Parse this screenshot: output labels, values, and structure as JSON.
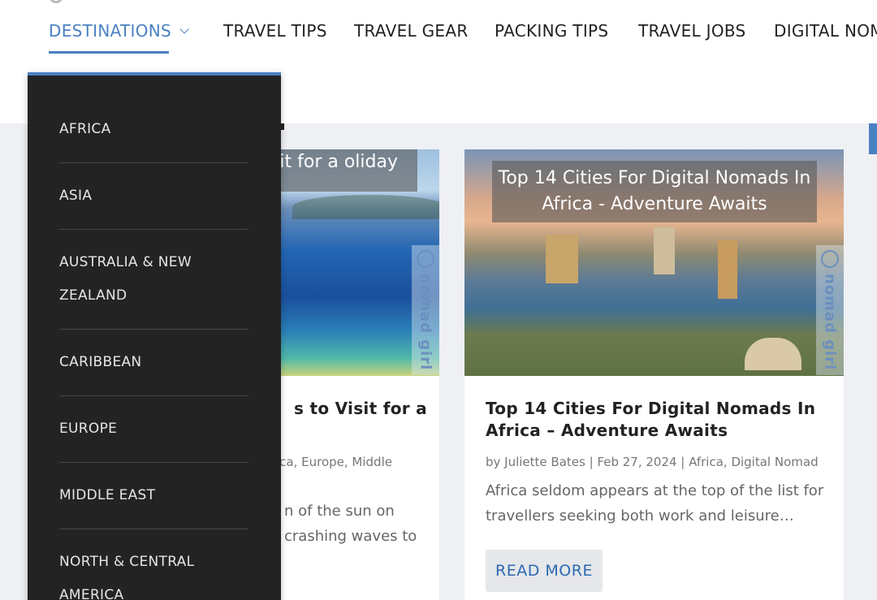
{
  "nav": {
    "items": [
      {
        "label": "DESTINATIONS",
        "active": true,
        "has_dropdown": true
      },
      {
        "label": "TRAVEL TIPS"
      },
      {
        "label": "TRAVEL GEAR"
      },
      {
        "label": "PACKING TIPS"
      },
      {
        "label": "TRAVEL JOBS"
      },
      {
        "label": "DIGITAL NOM"
      }
    ]
  },
  "dropdown": {
    "items": [
      {
        "label": "AFRICA"
      },
      {
        "label": "ASIA"
      },
      {
        "label": "AUSTRALIA & NEW ZEALAND"
      },
      {
        "label": "CARIBBEAN"
      },
      {
        "label": "EUROPE"
      },
      {
        "label": "MIDDLE EAST"
      },
      {
        "label": "NORTH & CENTRAL AMERICA"
      }
    ]
  },
  "cards": [
    {
      "image_banner": "ns to Visit for a oliday",
      "watermark": "nomad girl",
      "title": "s to Visit for a",
      "meta": "ica, Europe, Middle",
      "excerpt": "n of the sun on crashing waves to"
    },
    {
      "image_banner": "Top 14 Cities For Digital Nomads In Africa - Adventure Awaits",
      "watermark": "nomad girl",
      "title": "Top 14 Cities For Digital Nomads In Africa – Adventure Awaits",
      "meta": "by Juliette Bates | Feb 27, 2024 | Africa, Digital Nomad",
      "excerpt": "Africa seldom appears at the top of the list for travellers seeking both work and leisure…",
      "button_label": "READ MORE"
    }
  ],
  "colors": {
    "accent": "#4a81c2",
    "dropdown_bg": "#232323",
    "content_bg": "#eef0f4",
    "button_text": "#2d68b2"
  }
}
